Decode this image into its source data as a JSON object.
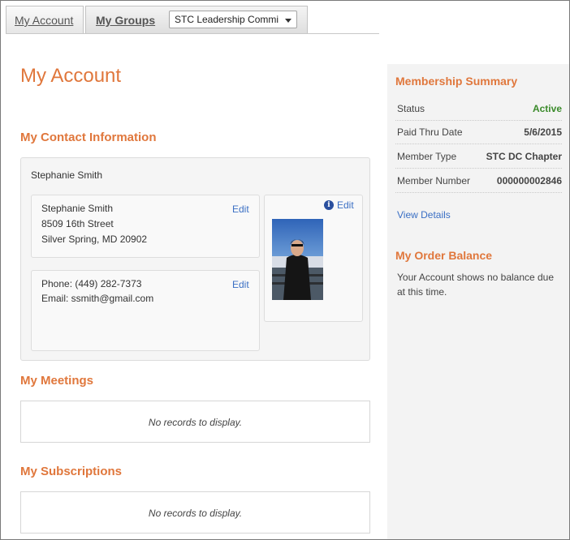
{
  "tabs": {
    "my_account": "My Account",
    "my_groups": "My Groups",
    "group_select_value": "STC Leadership Commi"
  },
  "main": {
    "title": "My Account",
    "contact_heading": "My Contact Information",
    "contact_name": "Stephanie Smith",
    "address": {
      "name": "Stephanie Smith",
      "street": "8509 16th Street",
      "city_line": "Silver Spring, MD 20902",
      "edit_label": "Edit"
    },
    "contact": {
      "phone": "Phone: (449) 282-7373",
      "email": "Email: ssmith@gmail.com",
      "edit_label": "Edit"
    },
    "photo": {
      "edit_label": "Edit",
      "info_glyph": "i"
    },
    "meetings_heading": "My Meetings",
    "meetings_empty": "No records to display.",
    "subscriptions_heading": "My Subscriptions",
    "subscriptions_empty": "No records to display."
  },
  "sidebar": {
    "summary_heading": "Membership Summary",
    "rows": [
      {
        "label": "Status",
        "value": "Active"
      },
      {
        "label": "Paid Thru Date",
        "value": "5/6/2015"
      },
      {
        "label": "Member Type",
        "value": "STC DC Chapter"
      },
      {
        "label": "Member Number",
        "value": "000000002846"
      }
    ],
    "view_details": "View Details",
    "balance_heading": "My Order Balance",
    "balance_text": "Your Account shows no balance due at this time."
  },
  "colors": {
    "accent": "#e0773c",
    "link": "#3a6fc4",
    "active_status": "#3a8a2a"
  }
}
